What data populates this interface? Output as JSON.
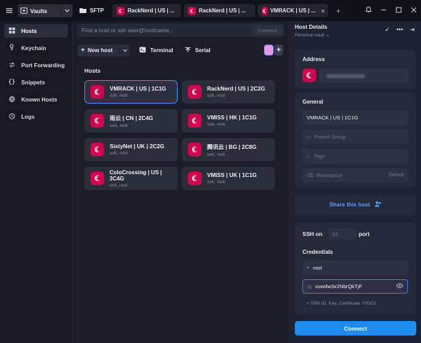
{
  "topbar": {
    "vaults_label": "Vaults",
    "tabs": [
      {
        "label": "SFTP"
      },
      {
        "label": "RackNerd | US | ..."
      },
      {
        "label": "RackNerd | US | ..."
      },
      {
        "label": "VMRACK | US | ..."
      }
    ],
    "close_glyph": "×",
    "new_tab_glyph": "+"
  },
  "sidebar": {
    "items": [
      {
        "label": "Hosts",
        "icon": "hosts-icon",
        "active": true
      },
      {
        "label": "Keychain",
        "icon": "key-icon"
      },
      {
        "label": "Port Forwarding",
        "icon": "port-forwarding-icon"
      },
      {
        "label": "Snippets",
        "icon": "snippets-icon"
      },
      {
        "label": "Known Hosts",
        "icon": "known-hosts-icon"
      },
      {
        "label": "Logs",
        "icon": "logs-icon"
      }
    ]
  },
  "search": {
    "placeholder": "Find a host or ssh user@hostname...",
    "connect_label": "Connect"
  },
  "toolbar": {
    "new_host_label": "New host",
    "terminal_label": "Terminal",
    "serial_label": "Serial"
  },
  "hosts": {
    "section_label": "Hosts",
    "items": [
      {
        "title": "VMRACK | US | 1C1G",
        "subtitle": "ssh, root",
        "selected": true
      },
      {
        "title": "RackNerd | US | 2C2G",
        "subtitle": "ssh, root"
      },
      {
        "title": "雨云 | CN | 2C4G",
        "subtitle": "ssh, root"
      },
      {
        "title": "VMISS | HK | 1C1G",
        "subtitle": "ssh, root"
      },
      {
        "title": "SixtyNet | UK | 2C2G",
        "subtitle": "ssh, root"
      },
      {
        "title": "腾讯云 | BG | 2C8G",
        "subtitle": "ssh, root"
      },
      {
        "title": "ColoCrossing | US | 3C4G",
        "subtitle": "ssh, root"
      },
      {
        "title": "VMISS | UK | 1C1G",
        "subtitle": "ssh, root"
      }
    ]
  },
  "panel": {
    "title": "Host Details",
    "subtitle": "Personal vault",
    "address_label": "Address",
    "general_label": "General",
    "label_value": "VMRACK | US | 1C1G",
    "parent_group_placeholder": "Parent Group",
    "tags_placeholder": "Tags",
    "backspace_label": "Backspace",
    "backspace_value": "Default",
    "share_label": "Share this host",
    "ssh_on_label": "SSH on",
    "port_placeholder": "22",
    "port_label": "port",
    "credentials_label": "Credentials",
    "username_value": "root",
    "password_value": "vuwdw3x2NbrQkTjF",
    "add_key_label": "+ SSH ID, Key, Certificate, FIDO2",
    "connect_label": "Connect"
  },
  "colors": {
    "accent": "#1f8cf2",
    "debian": "#d5004a",
    "background": "#1b1e29"
  }
}
